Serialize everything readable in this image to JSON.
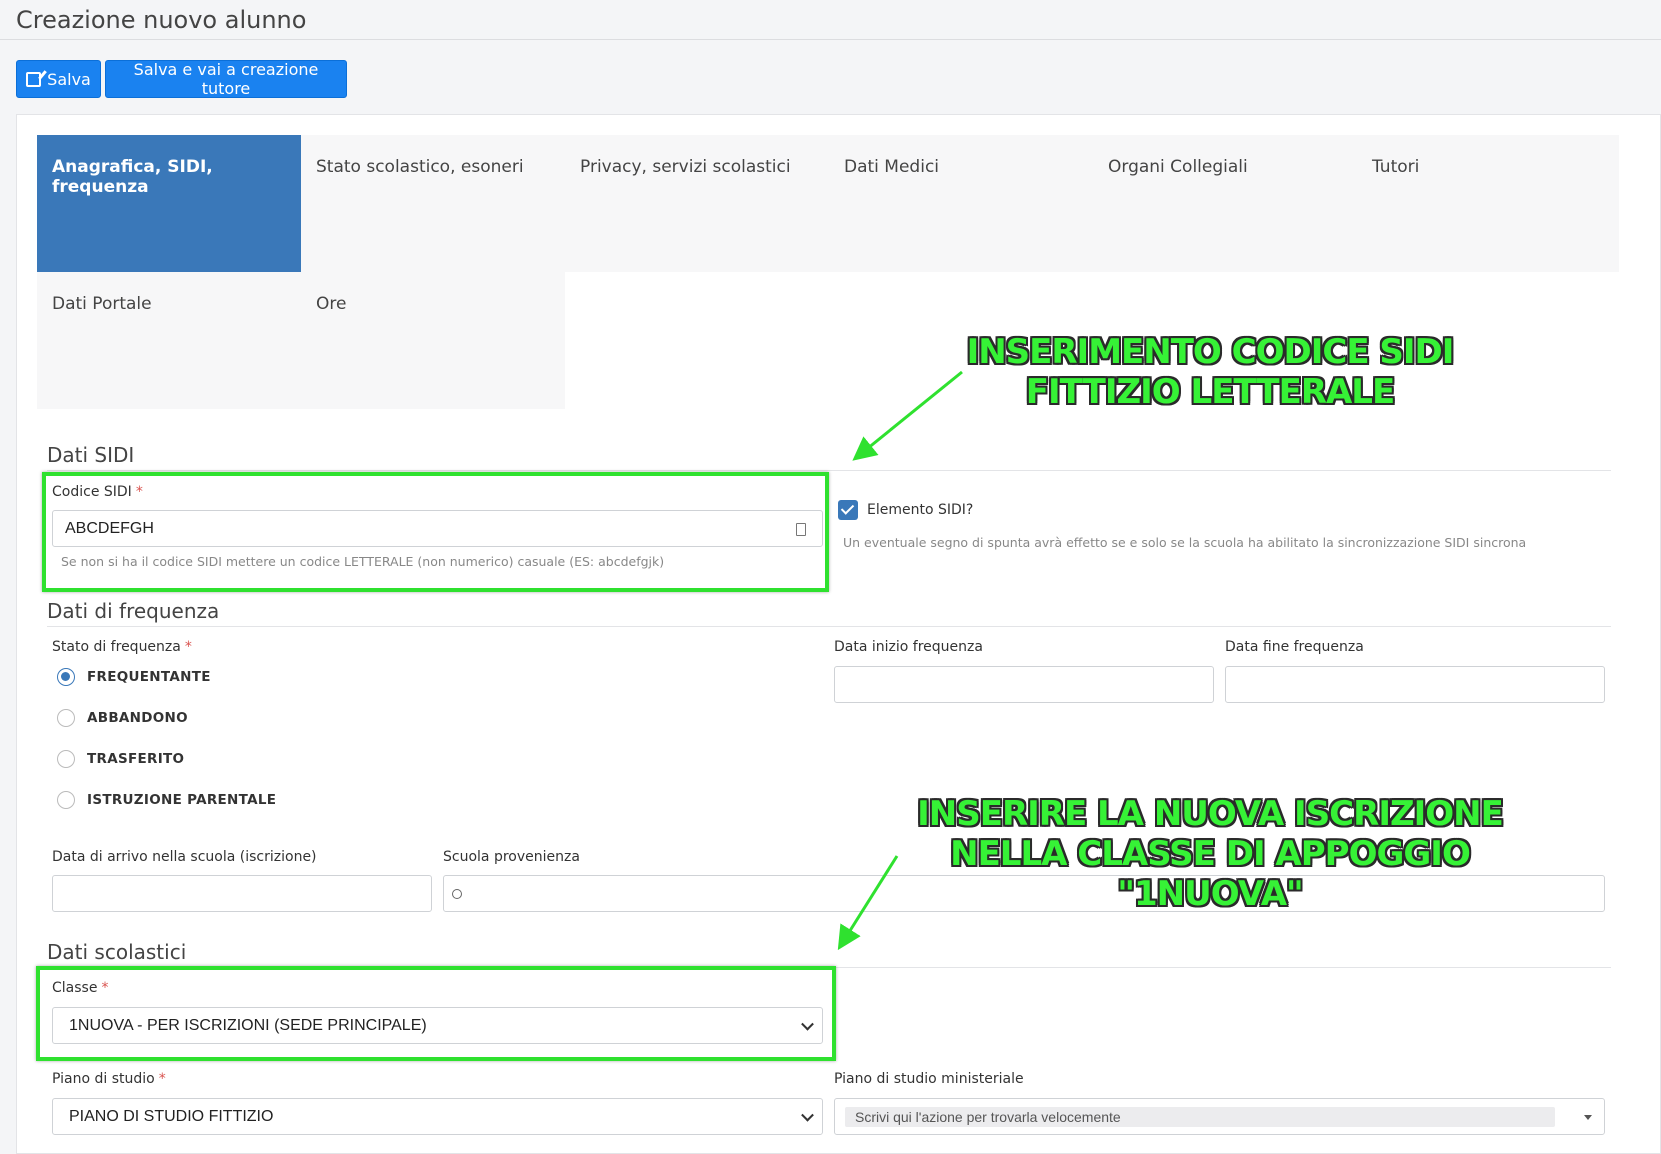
{
  "page": {
    "title": "Creazione nuovo alunno"
  },
  "toolbar": {
    "save_label": "Salva",
    "save_tutor_label": "Salva e vai a creazione tutore"
  },
  "tabs": [
    {
      "label": "Anagrafica, SIDI, frequenza"
    },
    {
      "label": "Stato scolastico, esoneri"
    },
    {
      "label": "Privacy, servizi scolastici"
    },
    {
      "label": "Dati Medici"
    },
    {
      "label": "Organi Collegiali"
    },
    {
      "label": "Tutori"
    },
    {
      "label": "Dati Portale"
    },
    {
      "label": "Ore"
    }
  ],
  "sidi": {
    "section_title": "Dati SIDI",
    "code_label": "Codice SIDI",
    "code_value": "ABCDEFGH",
    "code_help": "Se non si ha il codice SIDI mettere un codice LETTERALE (non numerico) casuale (ES: abcdefgjk)",
    "element_label": "Elemento SIDI?",
    "element_help": "Un eventuale segno di spunta avrà effetto se e solo se la scuola ha abilitato la sincronizzazione SIDI sincrona"
  },
  "frequency": {
    "section_title": "Dati di frequenza",
    "status_label": "Stato di frequenza",
    "options": [
      "FREQUENTANTE",
      "ABBANDONO",
      "TRASFERITO",
      "ISTRUZIONE PARENTALE"
    ],
    "selected": "FREQUENTANTE",
    "start_label": "Data inizio frequenza",
    "end_label": "Data fine frequenza",
    "arrival_label": "Data di arrivo nella scuola (iscrizione)",
    "origin_label": "Scuola provenienza"
  },
  "school": {
    "section_title": "Dati scolastici",
    "class_label": "Classe",
    "class_value": "1NUOVA - PER ISCRIZIONI (SEDE PRINCIPALE)",
    "plan_label": "Piano di studio",
    "plan_value": "PIANO DI STUDIO FITTIZIO",
    "ministerial_label": "Piano di studio ministeriale",
    "ministerial_placeholder": "Scrivi qui l'azione per trovarla velocemente"
  },
  "annotations": {
    "sidi_note": "INSERIMENTO CODICE SIDI\nFITTIZIO LETTERALE",
    "class_note": "INSERIRE LA NUOVA ISCRIZIONE\nNELLA CLASSE DI APPOGGIO\n\"1NUOVA\""
  },
  "colors": {
    "primary": "#1a82f0",
    "active_tab": "#3a78b9",
    "highlight": "#2fe12f",
    "required": "#d9534f"
  }
}
